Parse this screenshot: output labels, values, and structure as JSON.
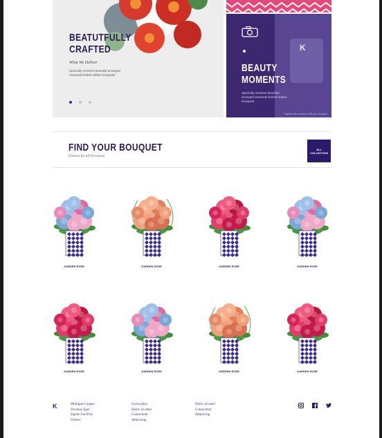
{
  "hero": {
    "title": "Beatutfully Crafted",
    "subtitle": "What We Deliver",
    "description": "Specially receeive beautiful arranged seasonal limited edition bouquets",
    "dots": 3,
    "active_dot": 0
  },
  "hero_right": {
    "title": "Beauty Moments",
    "description": "Specially receeive beautiful arranged seasonal limited edition bouquets",
    "brand_mark": "K",
    "caption": "Capture the moment with your bouquet"
  },
  "section": {
    "title": "Find Your Bouquet",
    "subtitle": "Flowers for all Occasions",
    "all_collection_label": "All Collection"
  },
  "products": [
    {
      "label": "Garden Rose",
      "style": "blue-pink"
    },
    {
      "label": "Garden Rose",
      "style": "peach"
    },
    {
      "label": "Garden Rose",
      "style": "red"
    },
    {
      "label": "Garden Rose",
      "style": "blue-pink"
    },
    {
      "label": "Garden Rose",
      "style": "red"
    },
    {
      "label": "Garden Rose",
      "style": "blue-pink"
    },
    {
      "label": "Garden Rose",
      "style": "peach"
    },
    {
      "label": "Garden Rose",
      "style": "red"
    }
  ],
  "footer": {
    "logo": "K",
    "col1": [
      "Mnilique Congue",
      "Vivamus Eget",
      "Sapien Facilisis",
      "Ornare"
    ],
    "col2": [
      "Lorem Ipsu",
      "Dolor sit amet",
      "Consectetur",
      "Adipiscing"
    ],
    "col3": [
      "Dolor sit amet",
      "Consectetur",
      "Adipiscing"
    ],
    "social": [
      "instagram-icon",
      "facebook-icon",
      "twitter-icon"
    ]
  },
  "colors": {
    "brand": "#2b1a6a",
    "accent_pink": "#e64678",
    "hero_purple": "#3c2870"
  }
}
